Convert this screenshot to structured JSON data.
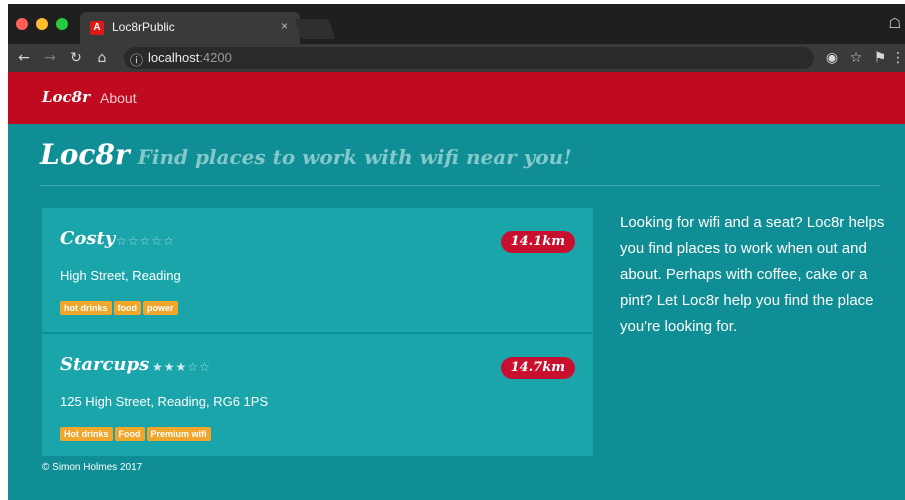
{
  "browser": {
    "tab_title": "Loc8rPublic",
    "tab_icon": "angular-icon",
    "tab_close": "×",
    "url_host": "localhost",
    "url_port": ":4200"
  },
  "navbar": {
    "brand": "Loc8r",
    "about": "About"
  },
  "header": {
    "brand": "Loc8r",
    "tagline": "Find places to work with wifi near you!"
  },
  "locations": [
    {
      "name": "Costy",
      "rating": 0,
      "distance": "14.1km",
      "address": "High Street, Reading",
      "tags": [
        "hot drinks",
        "food",
        "power"
      ]
    },
    {
      "name": "Starcups",
      "rating": 3,
      "distance": "14.7km",
      "address": "125 High Street, Reading, RG6 1PS",
      "tags": [
        "Hot drinks",
        "Food",
        "Premium wifi"
      ]
    }
  ],
  "sidebar": {
    "text": "Looking for wifi and a seat? Loc8r helps you find places to work when out and about. Perhaps with coffee, cake or a pint? Let Loc8r help you find the place you're looking for."
  },
  "footer": {
    "text": "© Simon Holmes 2017"
  },
  "colors": {
    "navbar": "#bf0a1f",
    "page_bg": "#0f8f95",
    "card_bg": "#1aa5ab",
    "distance_badge": "#c8102e",
    "tag": "#f0a52b"
  }
}
